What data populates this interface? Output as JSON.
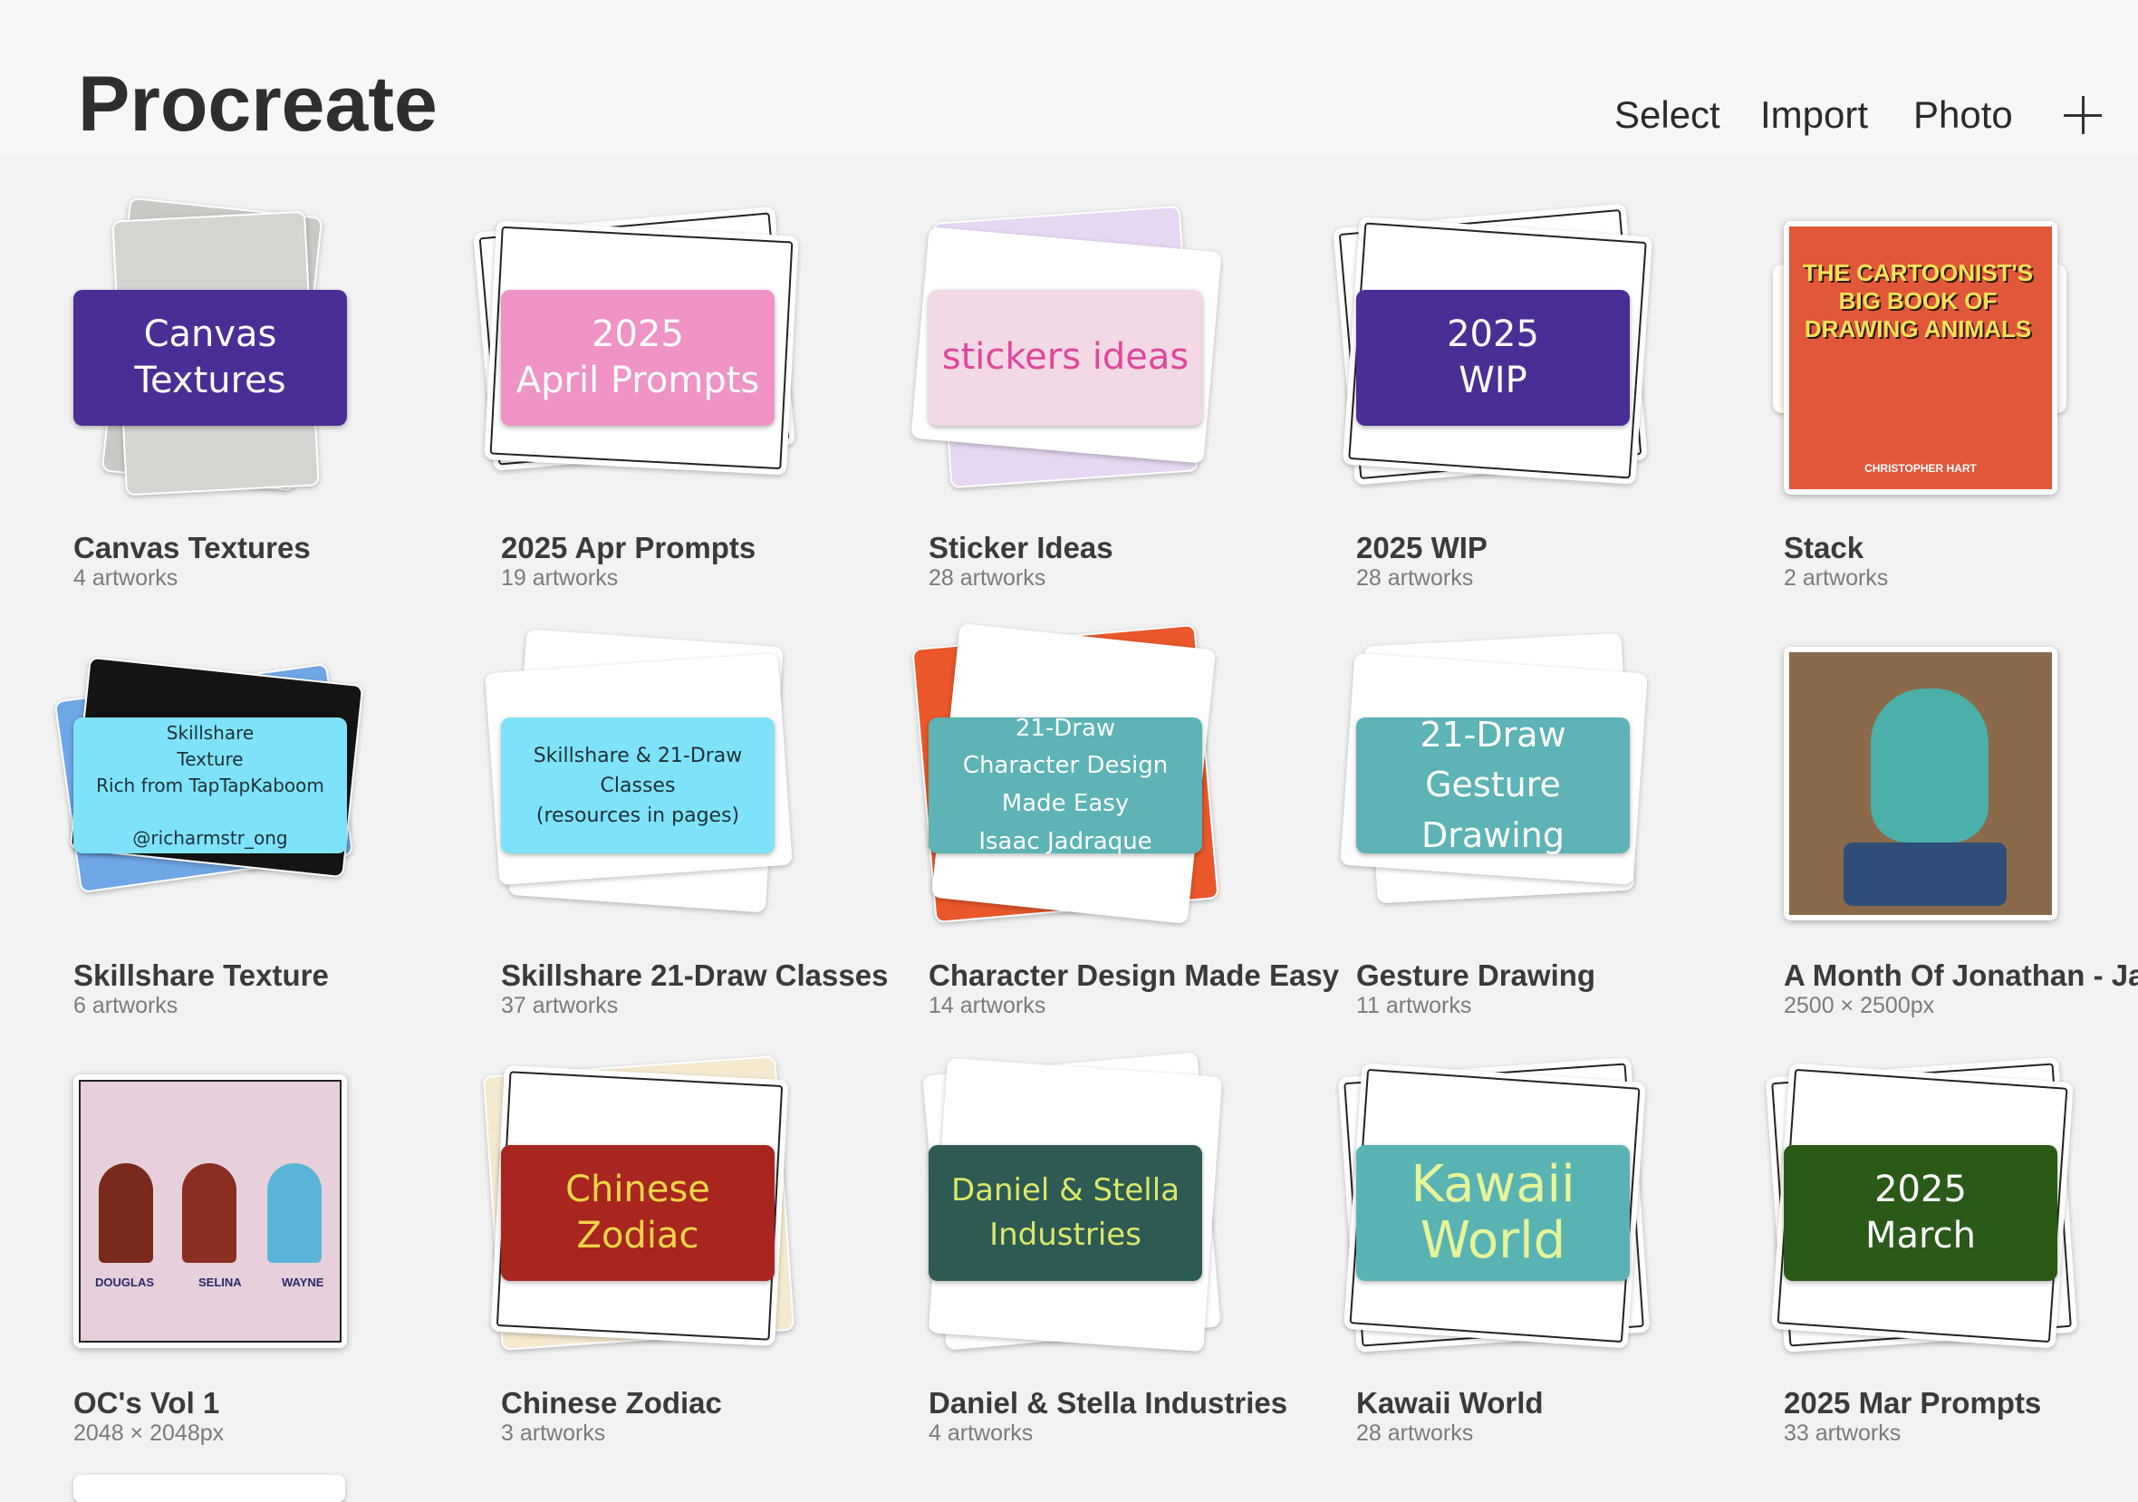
{
  "header": {
    "title": "Procreate",
    "select_label": "Select",
    "import_label": "Import",
    "photo_label": "Photo"
  },
  "gallery": [
    {
      "name": "Canvas Textures",
      "sub": "4 artworks",
      "cover_text": "Canvas\nTextures",
      "cover_color": "#4a2e96",
      "text_color": "#ffffff"
    },
    {
      "name": "2025 Apr Prompts",
      "sub": "19 artworks",
      "cover_text": "2025\nApril Prompts",
      "cover_color": "#ef92c5",
      "text_color": "#ffffff"
    },
    {
      "name": "Sticker Ideas",
      "sub": "28 artworks",
      "cover_text": "stickers ideas",
      "cover_color": "#f3d8e6",
      "text_color": "#e0479a"
    },
    {
      "name": "2025 WIP",
      "sub": "28 artworks",
      "cover_text": "2025\nWIP",
      "cover_color": "#4a2e96",
      "text_color": "#ffffff"
    },
    {
      "name": "Stack",
      "sub": "2 artworks",
      "book_title": "THE CARTOONIST'S BIG BOOK OF DRAWING ANIMALS",
      "book_author": "CHRISTOPHER HART"
    },
    {
      "name": "Skillshare Texture",
      "sub": "6 artworks",
      "cover_text": "Skillshare\nTexture\nRich from TapTapKaboom\n\n@richarmstr_ong",
      "cover_color": "#7ee3f8",
      "text_color": "#1f2f3a"
    },
    {
      "name": "Skillshare  21-Draw Classes",
      "sub": "37 artworks",
      "cover_text": "Skillshare & 21-Draw\nClasses\n(resources in pages)",
      "cover_color": "#7ee3f8",
      "text_color": "#1f2f3a"
    },
    {
      "name": "Character Design Made Easy",
      "sub": "14 artworks",
      "cover_text": "21-Draw\nCharacter Design Made Easy\nIsaac Jadraque",
      "cover_color": "#5db3b5",
      "text_color": "#ffffff"
    },
    {
      "name": "Gesture Drawing",
      "sub": "11 artworks",
      "cover_text": "21-Draw\nGesture Drawing",
      "cover_color": "#5db3b5",
      "text_color": "#ffffff"
    },
    {
      "name": "A Month Of Jonathan - Jan",
      "sub": "2500 × 2500px"
    },
    {
      "name": "OC's Vol 1",
      "sub": "2048 × 2048px",
      "characters": [
        "DOUGLAS",
        "SELINA",
        "WAYNE"
      ]
    },
    {
      "name": "Chinese Zodiac",
      "sub": "3 artworks",
      "cover_text": "Chinese Zodiac",
      "cover_color": "#a8261f",
      "text_color": "#f3d54a"
    },
    {
      "name": "Daniel & Stella Industries",
      "sub": "4 artworks",
      "cover_text": "Daniel & Stella\nIndustries",
      "cover_color": "#2d5a52",
      "text_color": "#d9e86a"
    },
    {
      "name": "Kawaii World",
      "sub": "28 artworks",
      "cover_text": "Kawaii\nWorld",
      "cover_color": "#5ab3b3",
      "text_color": "#e7f59a"
    },
    {
      "name": "2025 Mar Prompts",
      "sub": "33 artworks",
      "cover_text": "2025\nMarch",
      "cover_color": "#2a5a18",
      "text_color": "#ffffff"
    }
  ]
}
